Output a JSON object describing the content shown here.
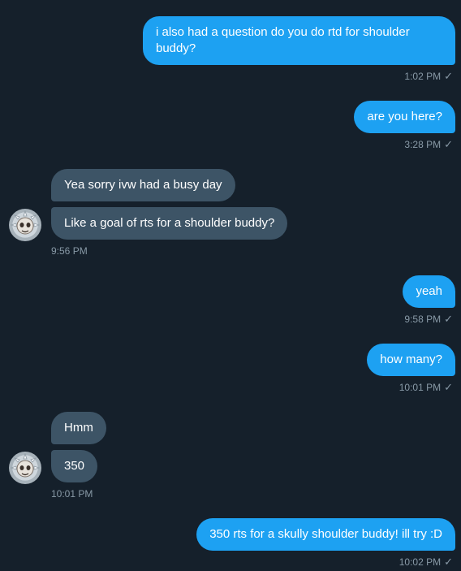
{
  "messages": [
    {
      "text": "i also had a question do you do rtd for shoulder buddy?",
      "time": "1:02 PM"
    },
    {
      "text": "are you here?",
      "time": "3:28 PM"
    },
    {
      "text": "Yea sorry ivw had a busy day"
    },
    {
      "text": "Like a goal of rts for a shoulder buddy?",
      "time": "9:56 PM"
    },
    {
      "text": "yeah",
      "time": "9:58 PM"
    },
    {
      "text": "how many?",
      "time": "10:01 PM"
    },
    {
      "text": "Hmm"
    },
    {
      "text": "350",
      "time": "10:01 PM"
    },
    {
      "text": "350 rts for a skully shoulder buddy! ill try :D",
      "time": "10:02 PM"
    }
  ],
  "icons": {
    "read_receipt": "checkmark-icon",
    "avatar": "skull-avatar"
  },
  "colors": {
    "background": "#15202b",
    "sent_bubble": "#1da1f2",
    "received_bubble": "#3d5466",
    "timestamp": "#8899a6"
  }
}
